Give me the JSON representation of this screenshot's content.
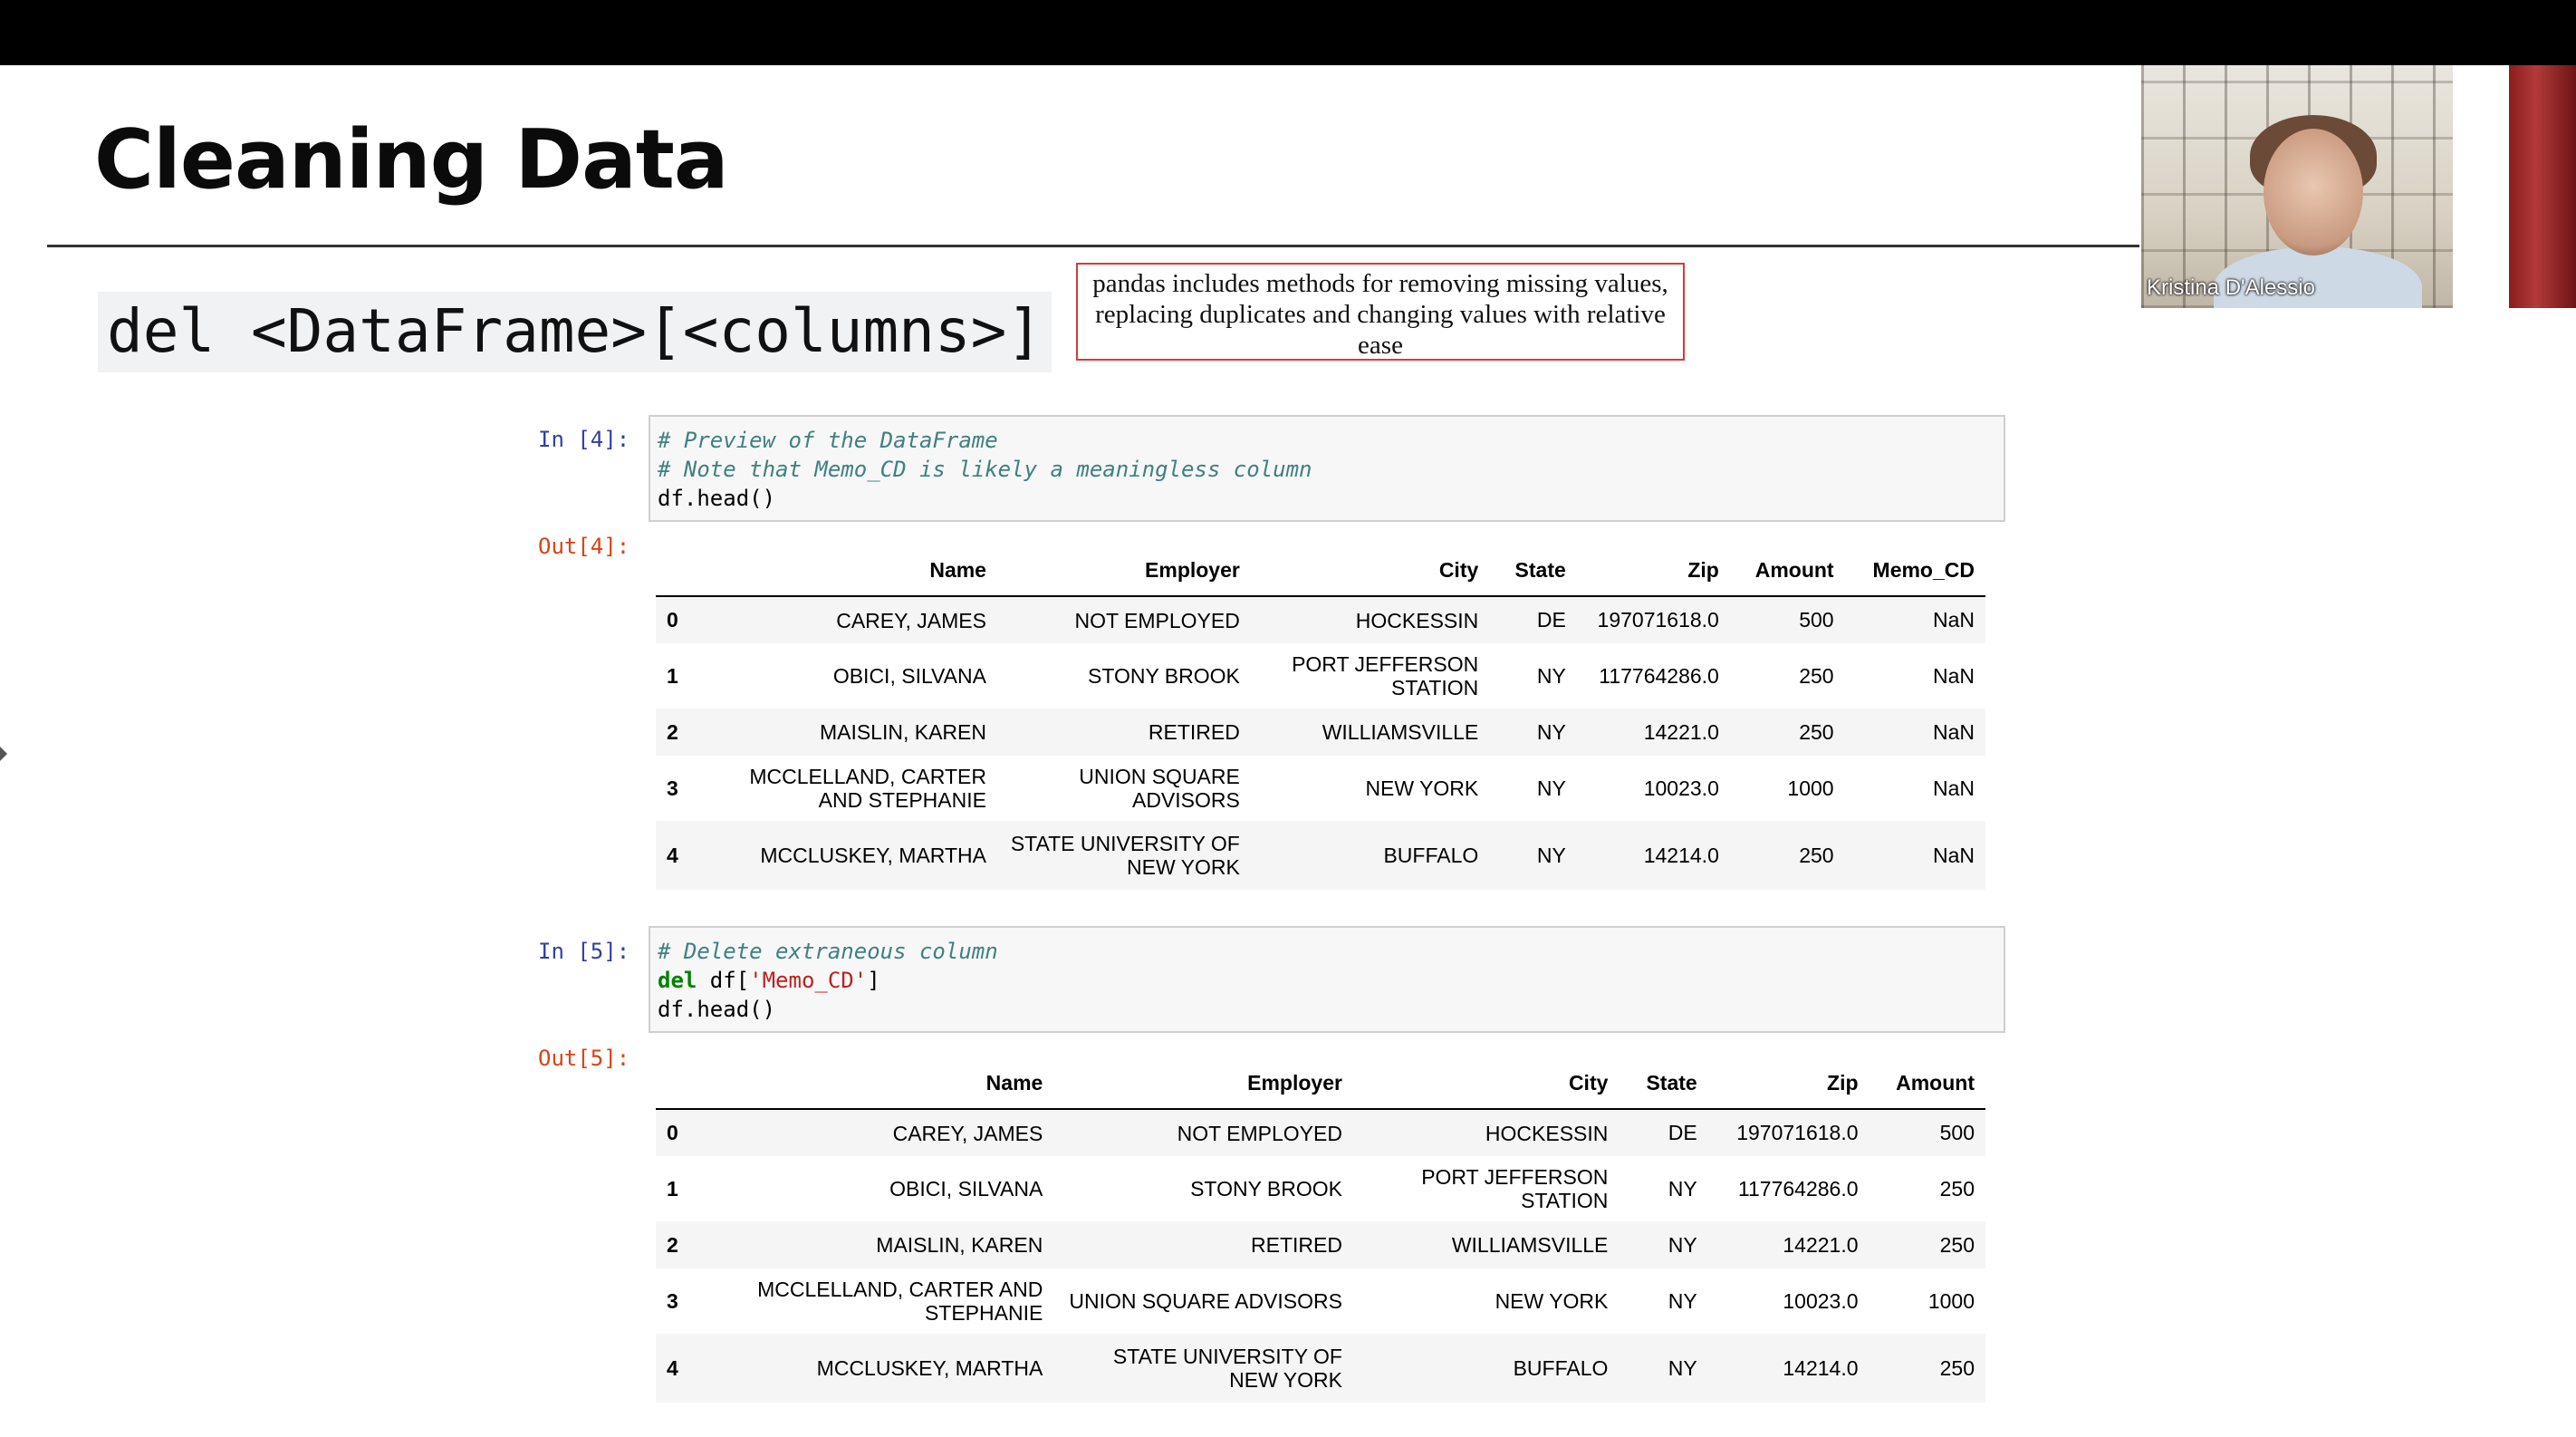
{
  "slide": {
    "title": "Cleaning Data",
    "syntax": "del <DataFrame>[<columns>]",
    "note": "pandas includes methods for removing missing values, replacing duplicates and changing values with relative ease"
  },
  "webcam": {
    "name": "Kristina D'Alessio"
  },
  "cells": [
    {
      "in_prompt": "In [4]:",
      "out_prompt": "Out[4]:",
      "code": [
        "# Preview of the DataFrame",
        "# Note that Memo_CD is likely a meaningless column",
        "df.head()"
      ],
      "table": {
        "columns": [
          "",
          "Name",
          "Employer",
          "City",
          "State",
          "Zip",
          "Amount",
          "Memo_CD"
        ],
        "rows": [
          [
            "0",
            "CAREY, JAMES",
            "NOT EMPLOYED",
            "HOCKESSIN",
            "DE",
            "197071618.0",
            "500",
            "NaN"
          ],
          [
            "1",
            "OBICI, SILVANA",
            "STONY BROOK",
            "PORT JEFFERSON STATION",
            "NY",
            "117764286.0",
            "250",
            "NaN"
          ],
          [
            "2",
            "MAISLIN, KAREN",
            "RETIRED",
            "WILLIAMSVILLE",
            "NY",
            "14221.0",
            "250",
            "NaN"
          ],
          [
            "3",
            "MCCLELLAND, CARTER AND STEPHANIE",
            "UNION SQUARE ADVISORS",
            "NEW YORK",
            "NY",
            "10023.0",
            "1000",
            "NaN"
          ],
          [
            "4",
            "MCCLUSKEY, MARTHA",
            "STATE UNIVERSITY OF NEW YORK",
            "BUFFALO",
            "NY",
            "14214.0",
            "250",
            "NaN"
          ]
        ]
      }
    },
    {
      "in_prompt": "In [5]:",
      "out_prompt": "Out[5]:",
      "code_comment": "# Delete extraneous column",
      "code_del_kw": "del",
      "code_del_pre": " df[",
      "code_del_str": "'Memo_CD'",
      "code_del_post": "]",
      "code_last": "df.head()",
      "table": {
        "columns": [
          "",
          "Name",
          "Employer",
          "City",
          "State",
          "Zip",
          "Amount"
        ],
        "rows": [
          [
            "0",
            "CAREY, JAMES",
            "NOT EMPLOYED",
            "HOCKESSIN",
            "DE",
            "197071618.0",
            "500"
          ],
          [
            "1",
            "OBICI, SILVANA",
            "STONY BROOK",
            "PORT JEFFERSON STATION",
            "NY",
            "117764286.0",
            "250"
          ],
          [
            "2",
            "MAISLIN, KAREN",
            "RETIRED",
            "WILLIAMSVILLE",
            "NY",
            "14221.0",
            "250"
          ],
          [
            "3",
            "MCCLELLAND, CARTER AND STEPHANIE",
            "UNION SQUARE ADVISORS",
            "NEW YORK",
            "NY",
            "10023.0",
            "1000"
          ],
          [
            "4",
            "MCCLUSKEY, MARTHA",
            "STATE UNIVERSITY OF NEW YORK",
            "BUFFALO",
            "NY",
            "14214.0",
            "250"
          ]
        ]
      }
    }
  ]
}
